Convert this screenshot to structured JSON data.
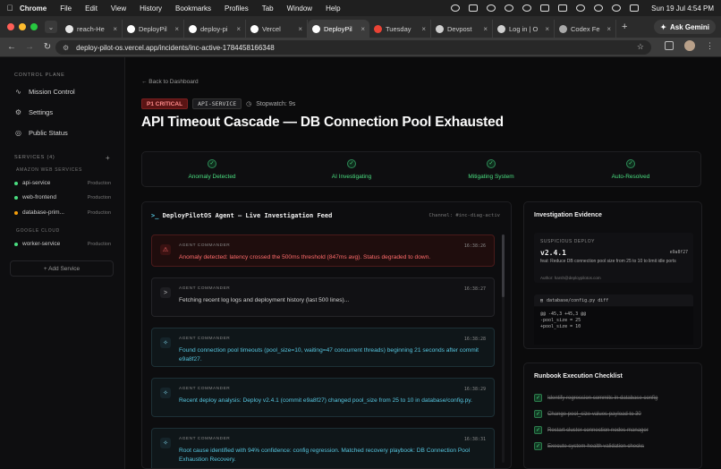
{
  "menubar": {
    "apple": "",
    "items": [
      "Chrome",
      "File",
      "Edit",
      "View",
      "History",
      "Bookmarks",
      "Profiles",
      "Tab",
      "Window",
      "Help"
    ],
    "clock": "Sun 19 Jul  4:54 PM"
  },
  "browser": {
    "tabs": [
      {
        "label": "reach-He",
        "favicon_color": "#e6e6e6"
      },
      {
        "label": "DeployPil",
        "favicon_color": "#ffffff"
      },
      {
        "label": "deploy-pi",
        "favicon_color": "#ffffff"
      },
      {
        "label": "Vercel",
        "favicon_color": "#ffffff"
      },
      {
        "label": "DeployPil",
        "favicon_color": "#ffffff"
      },
      {
        "label": "Tuesday",
        "favicon_color": "#ea4335"
      },
      {
        "label": "Devpost",
        "favicon_color": "#cfcfcf"
      },
      {
        "label": "Log in | O",
        "favicon_color": "#d0d0d0"
      },
      {
        "label": "Codex Fe",
        "favicon_color": "#aaaaaa"
      }
    ],
    "active_tab_index": 4,
    "ask_gemini": "Ask Gemini",
    "url": "deploy-pilot-os.vercel.app/incidents/inc-active-1784458166348"
  },
  "sidebar": {
    "control_plane_heading": "CONTROL PLANE",
    "nav": [
      {
        "label": "Mission Control",
        "icon": "activity-icon"
      },
      {
        "label": "Settings",
        "icon": "gear-icon"
      },
      {
        "label": "Public Status",
        "icon": "globe-icon"
      }
    ],
    "services_heading": "SERVICES (4)",
    "add_plus": "+",
    "groups": [
      {
        "name": "AMAZON WEB SERVICES",
        "services": [
          {
            "name": "api-service",
            "env": "Production",
            "status_color": "#4ade80"
          },
          {
            "name": "web-frontend",
            "env": "Production",
            "status_color": "#4ade80"
          },
          {
            "name": "database-prim...",
            "env": "Production",
            "status_color": "#f59e0b"
          }
        ]
      },
      {
        "name": "GOOGLE CLOUD",
        "services": [
          {
            "name": "worker-service",
            "env": "Production",
            "status_color": "#4ade80"
          }
        ]
      }
    ],
    "add_service": "+ Add Service"
  },
  "incident": {
    "back_link": "← Back to Dashboard",
    "severity": "P1 CRITICAL",
    "service": "API-SERVICE",
    "stopwatch": "Stopwatch: 9s",
    "title": "API Timeout Cascade — DB Connection Pool Exhausted",
    "stages": [
      "Anomaly Detected",
      "AI Investigating",
      "Mitigating System",
      "Auto-Resolved"
    ]
  },
  "feed": {
    "heading": "DeployPilotOS Agent — Live Investigation Feed",
    "heading_prefix": ">_",
    "channel": "Channel: #inc-diag-activ",
    "entries": [
      {
        "kind": "err",
        "icon": "alert-icon",
        "who": "AGENT COMMANDER",
        "time": "16:38:26",
        "msg": "Anomaly detected: latency crossed the 500ms threshold (847ms avg). Status degraded to down."
      },
      {
        "kind": "plain",
        "icon": "terminal-icon",
        "who": "AGENT COMMANDER",
        "time": "16:38:27",
        "msg": "Fetching recent log logs and deployment history (last 500 lines)..."
      },
      {
        "kind": "info",
        "icon": "sparkle-icon",
        "who": "AGENT COMMANDER",
        "time": "16:38:28",
        "msg": "Found connection pool timeouts (pool_size=10, waiting=47 concurrent threads) beginning 21 seconds after commit e9a8f27."
      },
      {
        "kind": "info",
        "icon": "sparkle-icon",
        "who": "AGENT COMMANDER",
        "time": "16:38:29",
        "msg": "Recent deploy analysis: Deploy v2.4.1 (commit e9a8f27) changed pool_size from 25 to 10 in database/config.py."
      },
      {
        "kind": "info",
        "icon": "sparkle-icon",
        "who": "AGENT COMMANDER",
        "time": "16:38:31",
        "msg": "Root cause identified with 94% confidence: config regression. Matched recovery playbook: DB Connection Pool Exhaustion Recovery."
      }
    ]
  },
  "evidence": {
    "heading": "Investigation Evidence",
    "deploy_label": "SUSPICIOUS DEPLOY",
    "version": "v2.4.1",
    "sha": "e9a8f27",
    "commit_msg": "feat: Reduce DB connection pool size from 25 to 10 to limit idle ports",
    "author": "Author: harsh@deploypilotos.com",
    "diff_file": "database/config.py  diff",
    "diff_lines": [
      "@@ -45,3 +45,3 @@",
      "-pool_size = 25",
      "+pool_size = 10"
    ]
  },
  "runbook": {
    "heading": "Runbook Execution Checklist",
    "items": [
      "Identify regression commits in database config",
      "Change pool_size values payload to 30",
      "Restart cluster connection nodes manager",
      "Execute system-health validation checks"
    ]
  }
}
